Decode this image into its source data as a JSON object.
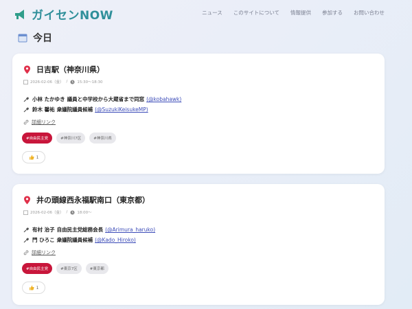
{
  "header": {
    "logo_text": "ガイセンNOW",
    "nav": [
      "ニュース",
      "このサイトについて",
      "情報提供",
      "参加する",
      "お問い合わせ"
    ]
  },
  "section": {
    "title": "今日"
  },
  "events": [
    {
      "station": "日吉駅（神奈川県）",
      "date": "2026-02-06（金）",
      "time": "15:30〜18:30",
      "speakers": [
        {
          "name": "小林 たかゆき",
          "role": "議員と中学校から大蔵省まで同窓",
          "handle": "(@kobahawk)"
        },
        {
          "name": "鈴木 馨祐",
          "role": "衆議院議員候補",
          "handle": "(@SuzukiKeisukeMP)"
        }
      ],
      "detail_label": "詳細リンク",
      "tags": [
        "#自由民主党",
        "#神奈川7区",
        "#神奈川県"
      ],
      "likes": "1"
    },
    {
      "station": "井の頭線西永福駅南口（東京都）",
      "date": "2026-02-06（金）",
      "time": "18:00〜",
      "speakers": [
        {
          "name": "有村 治子",
          "role": "自由民主党総務会長",
          "handle": "(@Arimura_haruko)"
        },
        {
          "name": "門 ひろこ",
          "role": "衆議院議員候補",
          "handle": "(@Kado_Hiroko)"
        }
      ],
      "detail_label": "詳細リンク",
      "tags": [
        "#自由民主党",
        "#東京7区",
        "#東京都"
      ],
      "likes": "1"
    }
  ],
  "colors": {
    "brand": "#2f8f9a",
    "party_tag": "#c8163b",
    "link": "#3b4bb8",
    "pin": "#e0304a"
  },
  "icons": {
    "logo": "megaphone-icon",
    "section": "calendar-icon",
    "location": "pin-icon",
    "speaker": "microphone-icon",
    "link": "link-icon",
    "like": "thumbs-up-icon"
  }
}
